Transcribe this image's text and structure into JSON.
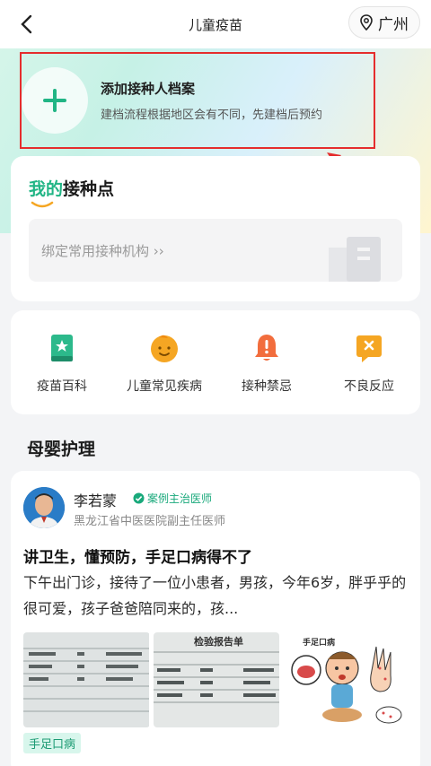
{
  "header": {
    "title": "儿童疫苗",
    "location": "广州"
  },
  "add_profile": {
    "title": "添加接种人档案",
    "subtitle": "建档流程根据地区会有不同，先建档后预约"
  },
  "my_points": {
    "title_green": "我的",
    "title_rest": "接种点",
    "bind_text": "绑定常用接种机构 ››"
  },
  "categories": [
    {
      "label": "疫苗百科",
      "icon": "book-icon",
      "color": "#2cb98b"
    },
    {
      "label": "儿童常见疾病",
      "icon": "baby-face-icon",
      "color": "#f5a623"
    },
    {
      "label": "接种禁忌",
      "icon": "bell-alert-icon",
      "color": "#f26d3d"
    },
    {
      "label": "不良反应",
      "icon": "warning-chat-icon",
      "color": "#f5a623"
    }
  ],
  "section": {
    "title": "母婴护理"
  },
  "article": {
    "author_name": "李若蒙",
    "badge": "案例主治医师",
    "author_title": "黑龙江省中医医院副主任医师",
    "title": "讲卫生，懂预防，手足口病得不了",
    "body": "下午出门诊，接待了一位小患者，男孩，今年6岁，胖乎乎的很可爱，孩子爸爸陪同来的，孩...",
    "thumb_caption": "检验报告单",
    "thumb3_caption": "手足口病",
    "tag": "手足口病"
  },
  "colors": {
    "accent_green": "#21b585",
    "highlight_red": "#e52d2d"
  }
}
